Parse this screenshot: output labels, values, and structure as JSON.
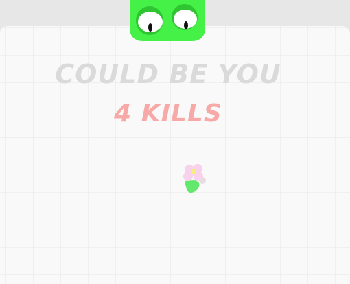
{
  "headline": {
    "main": "COULD BE YOU",
    "sub": "4 KILLS"
  },
  "player": {
    "icon": "green-blob-with-eyes",
    "color": "#45f146"
  },
  "pickup": {
    "icon": "pink-flower"
  },
  "colors": {
    "background": "#f9f9f9",
    "top_bar": "#e7e7e7",
    "headline_main": "#dadada",
    "headline_sub": "#f6a9a6",
    "player_body": "#45f146",
    "player_shade": "#2fc432"
  }
}
